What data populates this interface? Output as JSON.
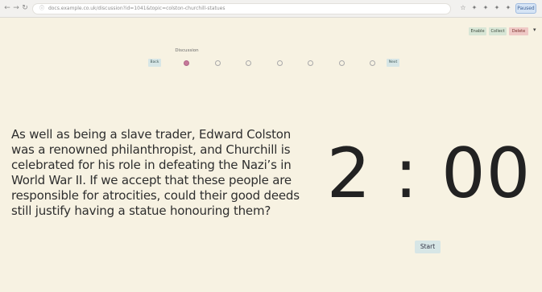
{
  "browser": {
    "url": "docs.example.co.uk/discussion?id=1041&topic=colston-churchill-statues",
    "profile_label": "Paused"
  },
  "toolbar": {
    "tool_a": "Enable",
    "tool_b": "Collect",
    "tool_c": "Delete",
    "caret": "▾"
  },
  "discussion": {
    "label": "Discussion",
    "prev_label": "Back",
    "next_label": "Next",
    "step_count": 7,
    "active_step": 1
  },
  "main": {
    "question": "As well as being a slave trader, Edward Colston was a renowned philanthropist, and Churchill is celebrated for his role in defeating the Nazi’s in World War II. If we accept that these people are responsible for atrocities, could their good deeds still justify having a statue honouring them?",
    "timer": "2 : 00",
    "start_label": "Start"
  },
  "icons": {
    "back": "←",
    "forward": "→",
    "reload": "↻",
    "info": "ⓘ",
    "star": "☆",
    "extension": "✦",
    "menu": "⋮"
  },
  "colors": {
    "background": "#f7f2e2",
    "active_dot": "#c7799a",
    "button": "#d7e6e6"
  }
}
